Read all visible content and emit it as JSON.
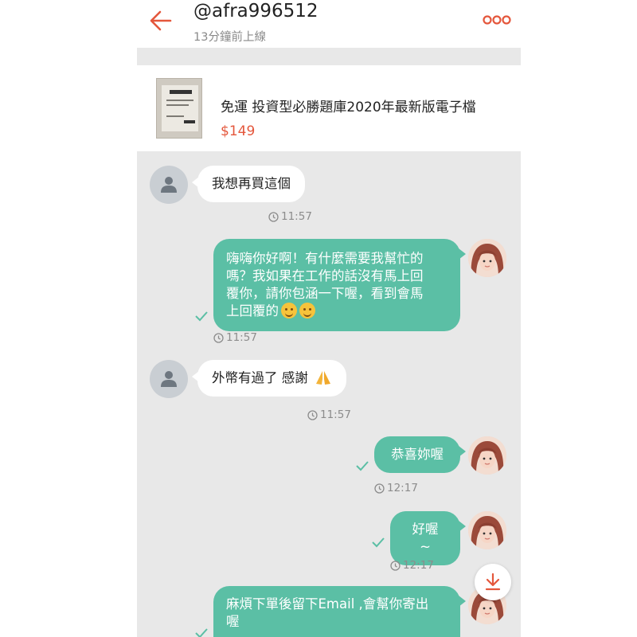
{
  "header": {
    "username": "@afra996512",
    "status": "13分鐘前上線"
  },
  "product": {
    "name": "免運 投資型必勝題庫2020年最新版電子檔",
    "price": "$149"
  },
  "messages": [
    {
      "side": "in",
      "text": "我想再買這個",
      "time": "11:57"
    },
    {
      "side": "out",
      "lines": [
        "嗨嗨你好啊！有什麼需要我幫忙的",
        "嗎？我如果在工作的話沒有馬上回",
        "覆你，請你包涵一下喔，看到會馬",
        "上回覆的"
      ],
      "emoji": [
        "hugging-face",
        "hugging-face"
      ],
      "time": "11:57"
    },
    {
      "side": "in",
      "text": "外幣有過了 感謝",
      "emoji": "folded-hands",
      "time": "11:57"
    },
    {
      "side": "out",
      "text": "恭喜妳喔",
      "time": "12:17"
    },
    {
      "side": "out",
      "text": "好喔 ~",
      "time": "12:17"
    },
    {
      "side": "out",
      "lines": [
        "麻煩下單後留下Email ,會幫你寄出",
        "喔"
      ]
    }
  ],
  "colors": {
    "accent": "#e4573c",
    "bubble_out": "#5bbfa5",
    "bubble_in": "#ffffff",
    "chat_background": "#e8e8e8"
  },
  "icons": {
    "back": "arrow-left-icon",
    "more": "more-dots-icon",
    "download": "download-icon"
  }
}
